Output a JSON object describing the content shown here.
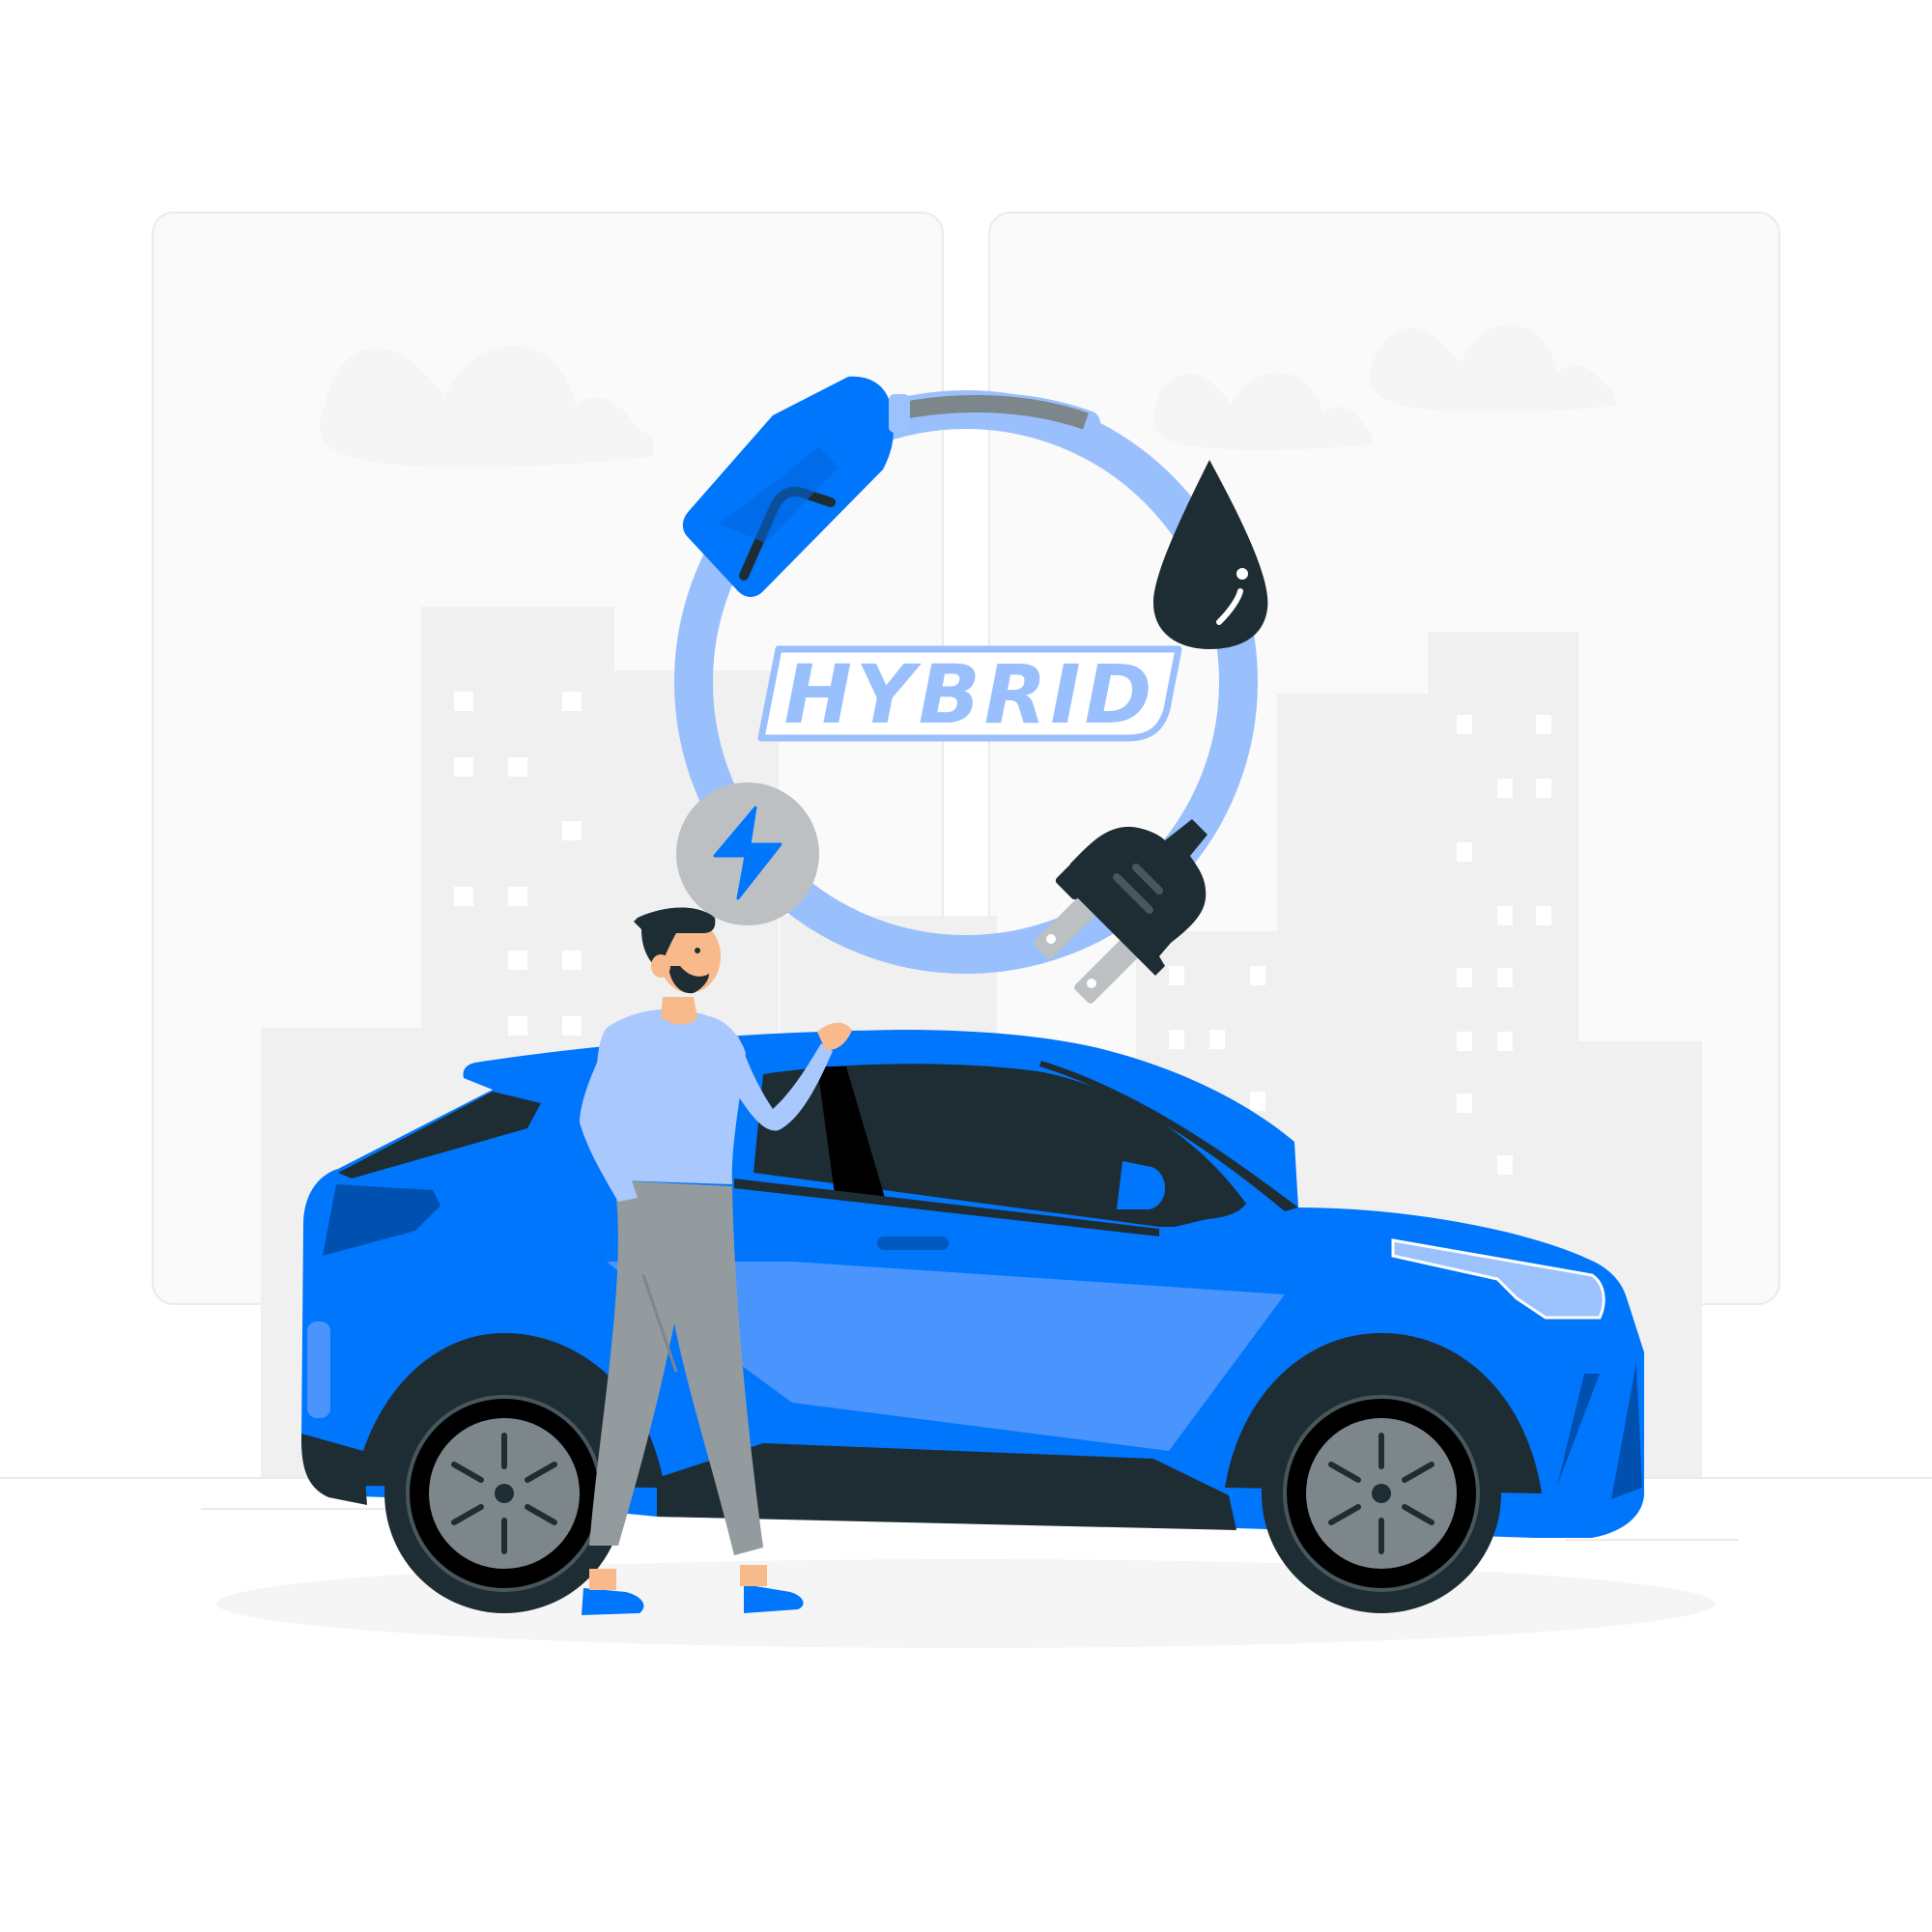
{
  "badge": {
    "label": "HYBRID"
  },
  "colors": {
    "background": "#ffffff",
    "panel": "#fafafa",
    "panel_border": "#ebebeb",
    "building": "#f0f0f0",
    "window": "#ffffff",
    "cloud": "#f5f5f5",
    "ground": "#f5f5f5",
    "ring": "#99bffc",
    "accent_blue": "#0076fd",
    "car_highlight": "#4a94fd",
    "car_light": "#9cc2fd",
    "dark": "#1e2d33",
    "bolt_circle": "#bcc0c2",
    "tire_rim": "#47575c",
    "hub": "#7d878b",
    "shirt": "#a9c8fd",
    "pants": "#949b9e",
    "skin": "#f8b98b",
    "shoe": "#0076fd"
  },
  "icons": [
    "fuel-nozzle-icon",
    "oil-drop-icon",
    "electric-plug-icon",
    "lightning-bolt-icon"
  ]
}
